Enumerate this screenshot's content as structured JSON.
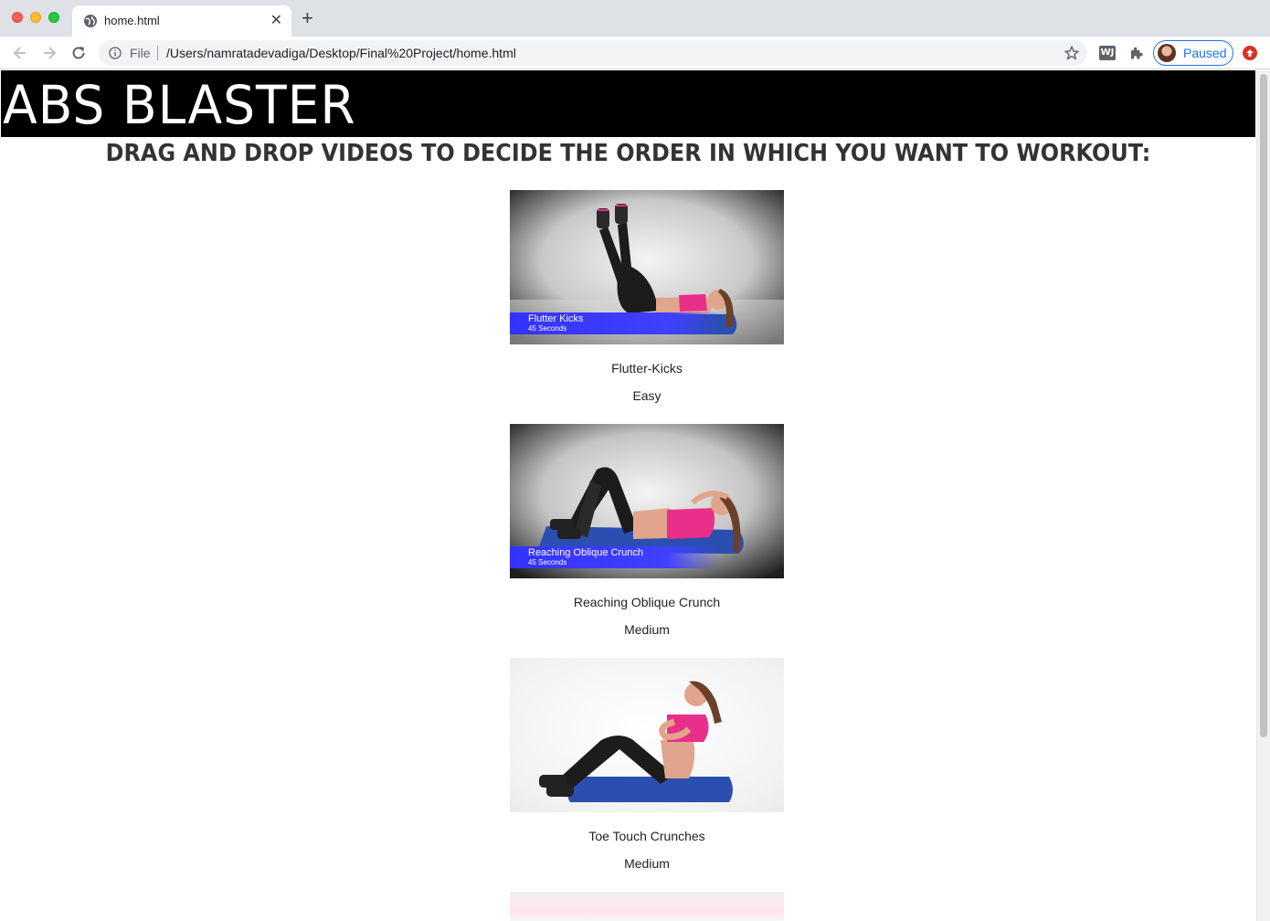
{
  "browser": {
    "tab_title": "home.html",
    "scheme": "File",
    "url": "/Users/namratadevadiga/Desktop/Final%20Project/home.html",
    "profile_label": "Paused",
    "new_tab_symbol": "+",
    "close_tab_symbol": "✕",
    "extension_badge": "WJ"
  },
  "site": {
    "title": "ABS BLASTER",
    "instructions": "DRAG AND DROP VIDEOS TO DECIDE THE ORDER IN WHICH YOU WANT TO WORKOUT:"
  },
  "videos": [
    {
      "overlay_name": "Flutter Kicks",
      "overlay_time": "45 Seconds",
      "name": "Flutter-Kicks",
      "level": "Easy"
    },
    {
      "overlay_name": "Reaching Oblique Crunch",
      "overlay_time": "45 Seconds",
      "name": "Reaching Oblique Crunch",
      "level": "Medium"
    },
    {
      "overlay_name": "",
      "overlay_time": "",
      "name": "Toe Touch Crunches",
      "level": "Medium"
    }
  ],
  "colors": {
    "header_bg": "#000000",
    "header_text": "#ffffff",
    "caption_bar": "#3333ff",
    "mat": "#2f56b8",
    "top_pink": "#e8308a"
  }
}
